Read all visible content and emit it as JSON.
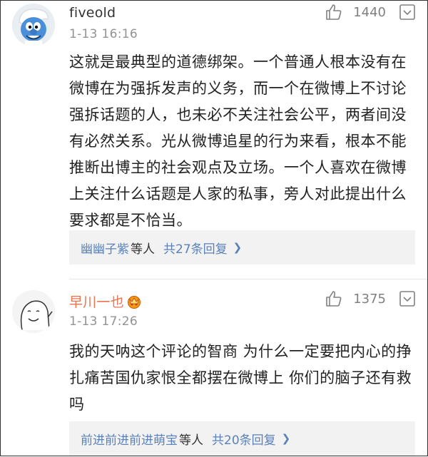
{
  "comments": [
    {
      "username": "fiveold",
      "timestamp": "1-13 16:16",
      "like_count": "1440",
      "text": "这就是最典型的道德绑架。一个普通人根本没有在微博在为强拆发声的义务，而一个在微博上不讨论强拆话题的人，也未必不关注社会公平，两者间没有必然关系。光从微博追星的行为来看，根本不能推断出博主的社会观点及立场。一个人喜欢在微博上关注什么话题是人家的私事，旁人对此提出什么要求都是不恰当。",
      "replies": {
        "who": "幽幽子紫",
        "etc": "等人",
        "count": "共27条回复"
      }
    },
    {
      "username": "早川一也",
      "timestamp": "1-13 17:26",
      "like_count": "1375",
      "text": "我的天呐这个评论的智商 为什么一定要把内心的挣扎痛苦国仇家恨全都摆在微博上 你们的脑子还有救吗",
      "replies": {
        "who": "前进前进前进萌宝",
        "etc": "等人",
        "count": "共20条回复"
      }
    }
  ],
  "colors": {
    "username_vip": "#eb7350",
    "link": "#5a82b9",
    "muted": "#939393"
  },
  "icons": [
    "smurf-avatar",
    "doodle-face-avatar",
    "thumbs-up-icon",
    "more-menu-icon",
    "vip-crown-badge-icon",
    "chevron-right-icon"
  ]
}
